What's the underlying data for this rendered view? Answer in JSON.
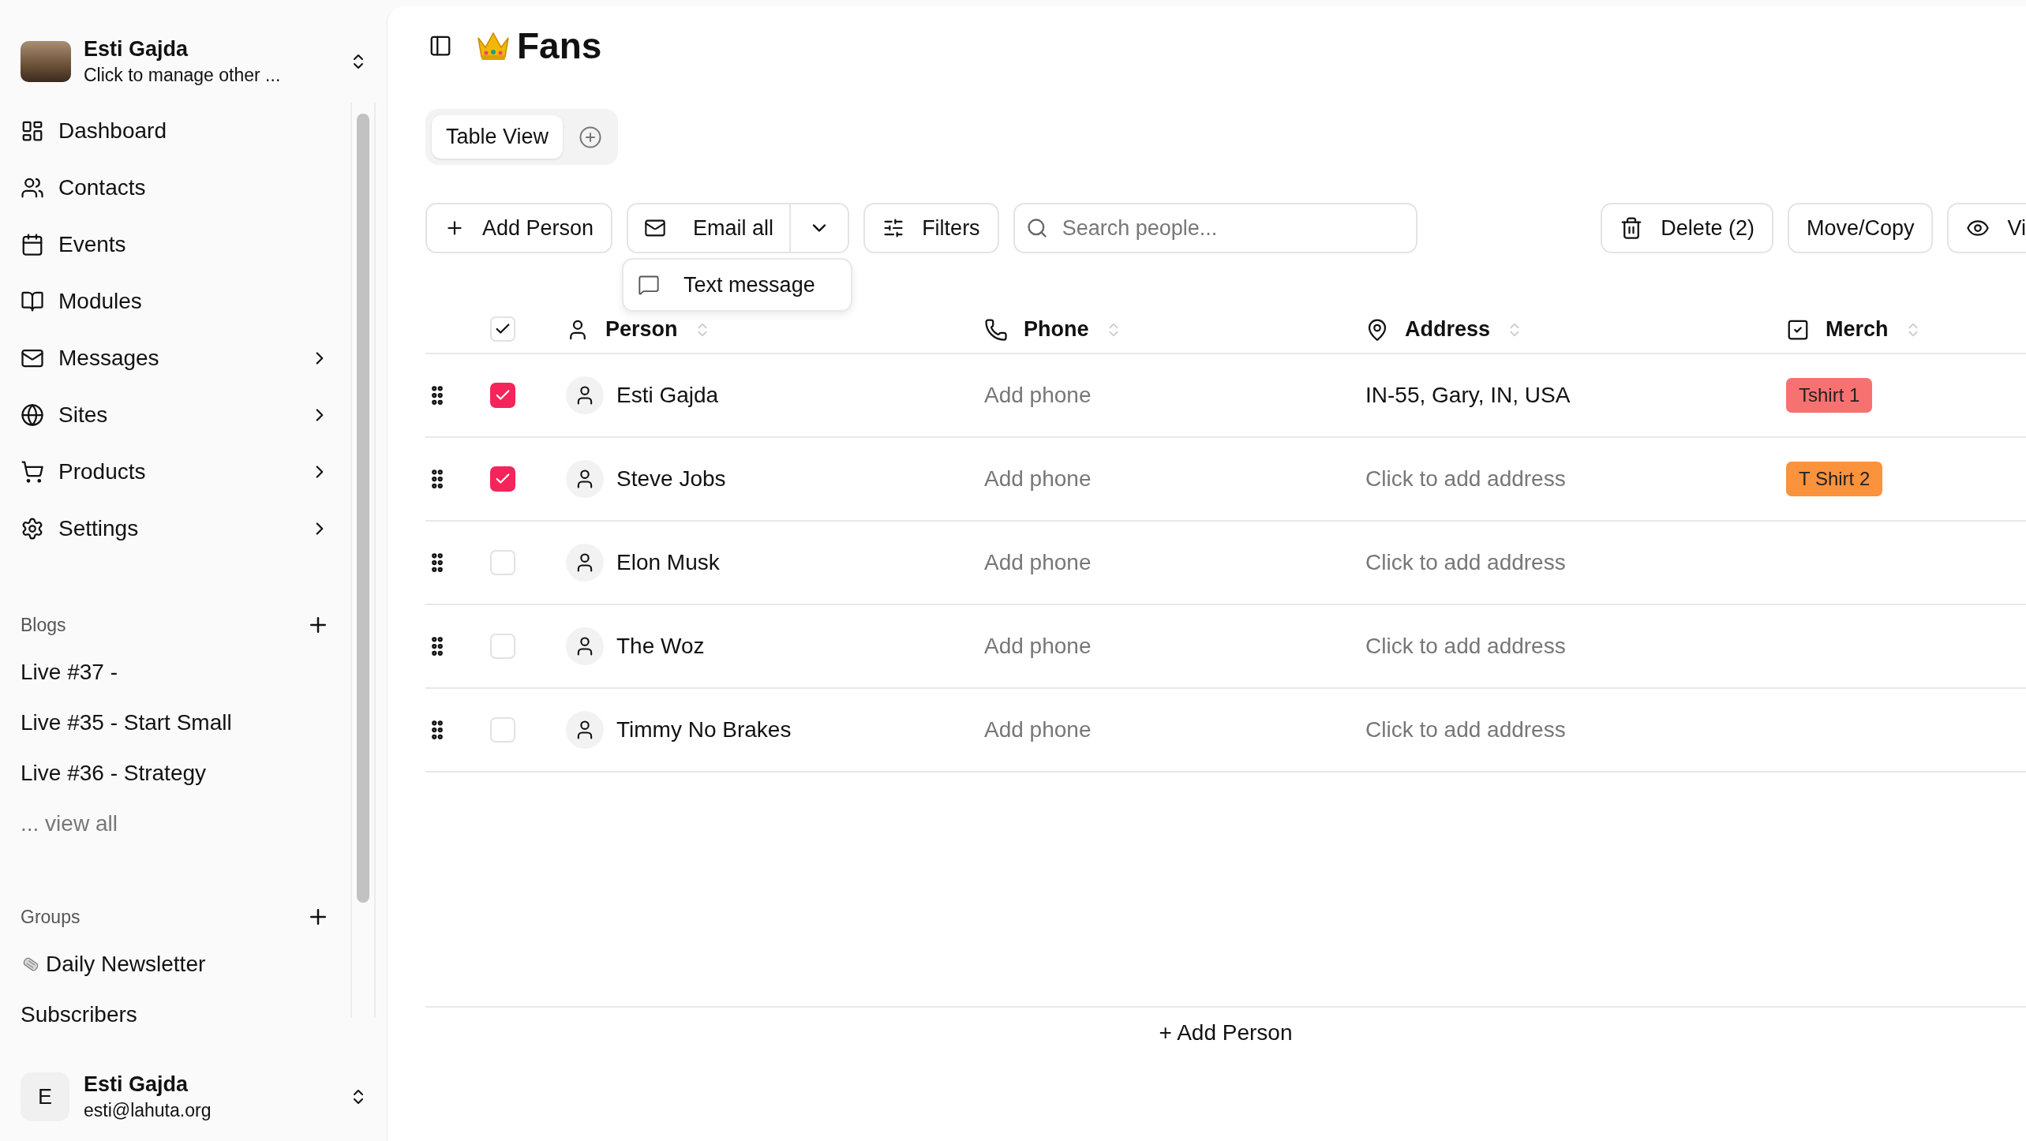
{
  "account": {
    "name": "Esti Gajda",
    "subtitle": "Click to manage other ..."
  },
  "nav": [
    {
      "label": "Dashboard",
      "has_submenu": false
    },
    {
      "label": "Contacts",
      "has_submenu": false
    },
    {
      "label": "Events",
      "has_submenu": false
    },
    {
      "label": "Modules",
      "has_submenu": false
    },
    {
      "label": "Messages",
      "has_submenu": true
    },
    {
      "label": "Sites",
      "has_submenu": true
    },
    {
      "label": "Products",
      "has_submenu": true
    },
    {
      "label": "Settings",
      "has_submenu": true
    }
  ],
  "blogs": {
    "title": "Blogs",
    "items": [
      "Live #37 -",
      "Live #35 - Start Small",
      "Live #36 - Strategy"
    ],
    "view_all": "... view all"
  },
  "groups": {
    "title": "Groups",
    "items": [
      "Daily Newsletter",
      "Subscribers"
    ]
  },
  "user": {
    "initial": "E",
    "name": "Esti Gajda",
    "email": "esti@lahuta.org"
  },
  "page": {
    "title": "Fans"
  },
  "views": [
    {
      "label": "Table View",
      "selected": true
    }
  ],
  "toolbar": {
    "add": "Add Person",
    "email": "Email all",
    "email_menu": [
      "Text message"
    ],
    "filters": "Filters",
    "search_placeholder": "Search people...",
    "delete": "Delete (2)",
    "move": "Move/Copy",
    "view": "Vi"
  },
  "table": {
    "all_checked": true,
    "columns": [
      "Person",
      "Phone",
      "Address",
      "Merch"
    ],
    "rows": [
      {
        "name": "Esti Gajda",
        "phone": "Add phone",
        "phone_empty": true,
        "address": "IN-55, Gary, IN, USA",
        "address_empty": false,
        "checked": true,
        "merch": {
          "label": "Tshirt 1",
          "color": "#f87171"
        }
      },
      {
        "name": "Steve Jobs",
        "phone": "Add phone",
        "phone_empty": true,
        "address": "Click to add address",
        "address_empty": true,
        "checked": true,
        "merch": {
          "label": "T Shirt 2",
          "color": "#fb923c"
        }
      },
      {
        "name": "Elon Musk",
        "phone": "Add phone",
        "phone_empty": true,
        "address": "Click to add address",
        "address_empty": true,
        "checked": false
      },
      {
        "name": "The Woz",
        "phone": "Add phone",
        "phone_empty": true,
        "address": "Click to add address",
        "address_empty": true,
        "checked": false
      },
      {
        "name": "Timmy No Brakes",
        "phone": "Add phone",
        "phone_empty": true,
        "address": "Click to add address",
        "address_empty": true,
        "checked": false
      }
    ],
    "add_row": "+ Add Person"
  }
}
